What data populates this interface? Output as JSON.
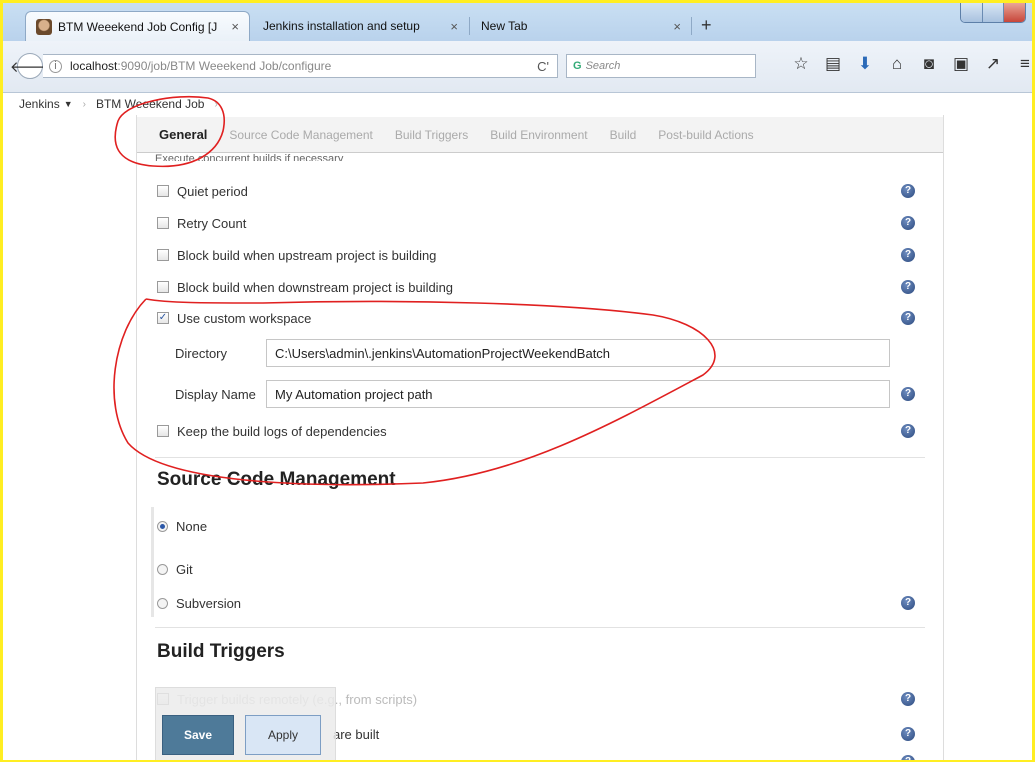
{
  "browser": {
    "tabs": [
      {
        "label": "BTM Weeekend Job Config [J"
      },
      {
        "label": "Jenkins installation and setup"
      },
      {
        "label": "New Tab"
      }
    ],
    "url_host": "localhost",
    "url_path": ":9090/job/BTM Weeekend Job/configure",
    "search_placeholder": "Search"
  },
  "breadcrumb": {
    "root": "Jenkins",
    "job": "BTM Weeekend Job"
  },
  "config_tabs": [
    "General",
    "Source Code Management",
    "Build Triggers",
    "Build Environment",
    "Build",
    "Post-build Actions"
  ],
  "general": {
    "peek_text": "Execute concurrent builds if necessary",
    "options": [
      {
        "label": "Quiet period",
        "checked": false
      },
      {
        "label": "Retry Count",
        "checked": false
      },
      {
        "label": "Block build when upstream project is building",
        "checked": false
      },
      {
        "label": "Block build when downstream project is building",
        "checked": false
      },
      {
        "label": "Use custom workspace",
        "checked": true
      }
    ],
    "directory_label": "Directory",
    "directory_value": "C:\\Users\\admin\\.jenkins\\AutomationProjectWeekendBatch",
    "display_name_label": "Display Name",
    "display_name_value": "My Automation project path",
    "keep_logs_label": "Keep the build logs of dependencies"
  },
  "scm": {
    "title": "Source Code Management",
    "options": [
      {
        "label": "None",
        "selected": true
      },
      {
        "label": "Git",
        "selected": false
      },
      {
        "label": "Subversion",
        "selected": false
      }
    ]
  },
  "triggers": {
    "title": "Build Triggers",
    "row1": "Trigger builds remotely (e.g., from scripts)",
    "row2": "are built"
  },
  "buttons": {
    "save": "Save",
    "apply": "Apply"
  },
  "colors": {
    "annotation": "#e02020",
    "frame": "#ffee22",
    "save_button": "#4e7a99"
  }
}
